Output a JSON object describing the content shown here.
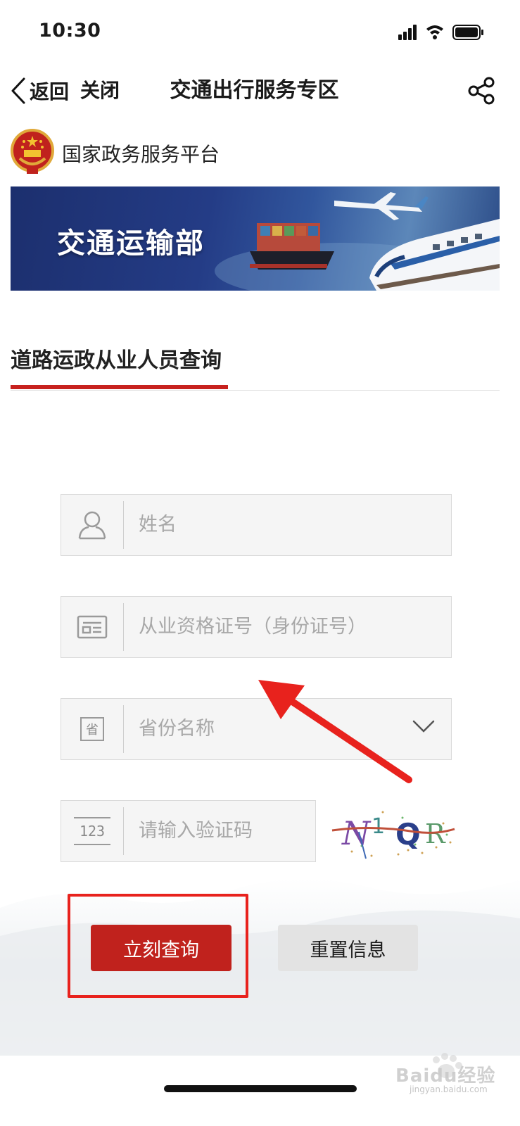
{
  "status_bar": {
    "time": "10:30"
  },
  "nav": {
    "back_label": "返回",
    "close_label": "关闭",
    "title": "交通出行服务专区"
  },
  "platform": {
    "name": "国家政务服务平台"
  },
  "banner": {
    "title": "交通运输部"
  },
  "section": {
    "tab_label": "道路运政从业人员查询"
  },
  "form": {
    "name_placeholder": "姓名",
    "id_placeholder": "从业资格证号（身份证号）",
    "province_placeholder": "省份名称",
    "captcha_placeholder": "请输入验证码",
    "captcha_icon_text": "123",
    "province_icon_text": "省",
    "captcha_chars": [
      "N",
      "1",
      "Q",
      "R"
    ]
  },
  "buttons": {
    "query_label": "立刻查询",
    "reset_label": "重置信息"
  },
  "watermark": {
    "brand": "Baidu经验",
    "url": "jingyan.baidu.com"
  },
  "colors": {
    "accent_red": "#c0221d",
    "annotation_red": "#e8221d",
    "banner_blue": "#243c86"
  }
}
